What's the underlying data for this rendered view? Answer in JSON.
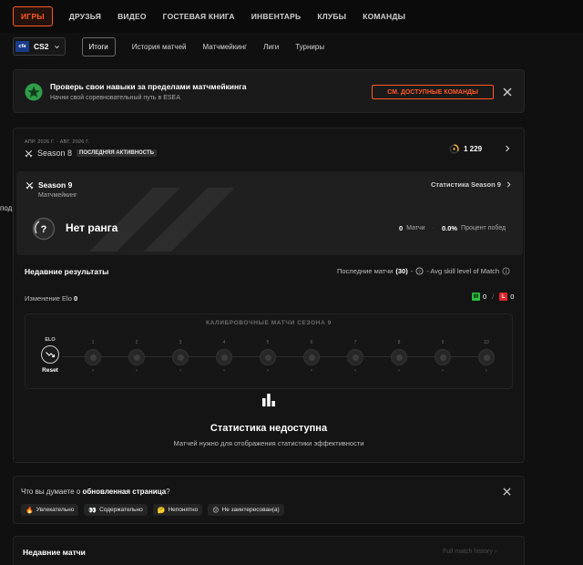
{
  "topnav": {
    "items": [
      "ИГРЫ",
      "ДРУЗЬЯ",
      "ВИДЕО",
      "ГОСТЕВАЯ КНИГА",
      "ИНВЕНТАРЬ",
      "КЛУБЫ",
      "КОМАНДЫ"
    ],
    "active": 0
  },
  "subnav": {
    "game_logo": "cfa",
    "game_name": "CS2",
    "tabs": [
      "Итоги",
      "История матчей",
      "Матчмейкинг",
      "Лиги",
      "Турниры"
    ],
    "active": 0
  },
  "promo": {
    "title": "Проверь свои навыки за пределами матчмейкинга",
    "subtitle": "Начни свой соревновательный путь в ESEA",
    "button": "СМ. ДОСТУПНЫЕ КОМАНДЫ",
    "accent": "#ff5a26"
  },
  "season": {
    "range": "АПР. 2026 Г. - АВГ. 2026 Г.",
    "label": "Season 8",
    "badge": "ПОСЛЕДНЯЯ АКТИВНОСТЬ",
    "elo": "1 229"
  },
  "rank": {
    "season_name": "Season 9",
    "mode": "Матчмейкинг",
    "stats_link": "Статистика Season 9",
    "title": "Нет ранга",
    "matches_value": "0",
    "matches_label": "Матчи",
    "winrate_value": "0.0%",
    "winrate_label": "Процент побед"
  },
  "results": {
    "title": "Недавние результаты",
    "filter_prefix": "Последние матчи",
    "filter_count": "(30)",
    "filter_suffix": "- Avg skill level of Match",
    "elo_change_label": "Изменение Elo",
    "elo_change_value": "0",
    "wins_badge": "W",
    "wins": "0",
    "losses_badge": "L",
    "losses": "0"
  },
  "calibration": {
    "title": "КАЛИБРОВОЧНЫЕ МАТЧИ СЕЗОНА 9",
    "start_label": "ELO",
    "reset_label": "Reset",
    "nodes": [
      "1",
      "2",
      "3",
      "4",
      "5",
      "6",
      "7",
      "8",
      "9",
      "10"
    ],
    "node_value": "•"
  },
  "unavailable": {
    "title": "Статистика недоступна",
    "subtitle": "Матчей нужно для отображения статистики эффективности"
  },
  "feedback": {
    "question_prefix": "Что вы думаете о",
    "question_bold": "обновленная страница",
    "question_suffix": "?",
    "options": [
      {
        "emoji": "🔥",
        "label": "Увлекательно"
      },
      {
        "emoji": "👀",
        "label": "Содержательно"
      },
      {
        "emoji": "🤔",
        "label": "Непонятно"
      },
      {
        "emoji": "😕",
        "label": "Не заинтересован(а)"
      }
    ]
  },
  "recent_matches": {
    "title": "Недавние матчи",
    "link": "Full match history ›"
  },
  "side_fragment": "под"
}
